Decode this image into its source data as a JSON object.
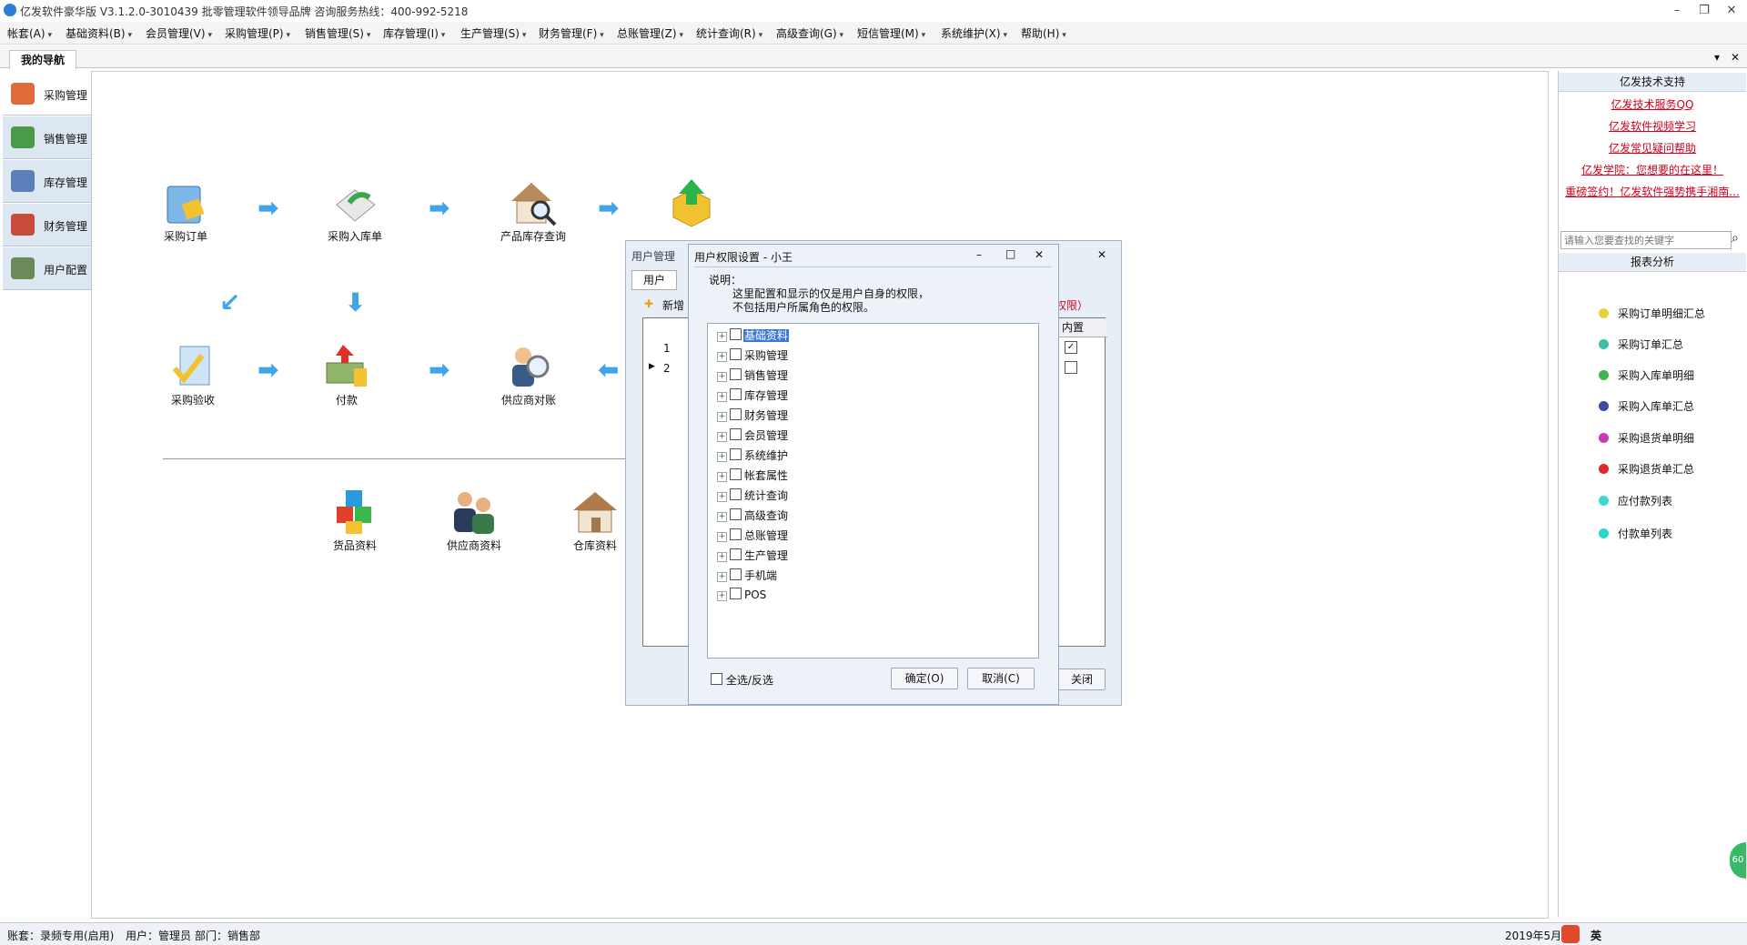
{
  "window": {
    "title": "亿发软件豪华版 V3.1.2.0-3010439 批零管理软件领导品牌 咨询服务热线：400-992-5218",
    "min": "–",
    "restore": "❐",
    "close": "✕"
  },
  "menu": [
    "帐套(A)",
    "基础资料(B)",
    "会员管理(V)",
    "采购管理(P)",
    "销售管理(S)",
    "库存管理(I)",
    "生产管理(S)",
    "财务管理(F)",
    "总账管理(Z)",
    "统计查询(R)",
    "高级查询(G)",
    "短信管理(M)",
    "系统维护(X)",
    "帮助(H)"
  ],
  "tabs": {
    "nav_tab": "我的导航",
    "dropdown": "▾",
    "close": "✕"
  },
  "leftnav": [
    {
      "label": "采购管理",
      "color": "#e06a3a"
    },
    {
      "label": "销售管理",
      "color": "#4a9a4a"
    },
    {
      "label": "库存管理",
      "color": "#5b7fb8"
    },
    {
      "label": "财务管理",
      "color": "#c84a3a"
    },
    {
      "label": "用户配置",
      "color": "#6a8a5a"
    }
  ],
  "flow": {
    "items": [
      "采购订单",
      "采购入库单",
      "产品库存查询",
      "",
      "采购验收",
      "付款",
      "供应商对账"
    ],
    "resources": [
      "货品资料",
      "供应商资料",
      "仓库资料"
    ],
    "arrow_right": "➡",
    "arrow_down": "⬇",
    "arrow_left": "⬅",
    "arrow_diag": "↙"
  },
  "userwin": {
    "title": "用户管理",
    "tab": "用户",
    "add": "新增",
    "perm_note": "权限）",
    "col_builtin": "内置",
    "rows": [
      {
        "no": "1",
        "mark": "✓"
      },
      {
        "no": "2",
        "mark": ""
      }
    ],
    "row_pointer": "▶",
    "close": "关闭",
    "x": "✕"
  },
  "dialog": {
    "title": "用户权限设置 - 小王",
    "note_label": "说明：",
    "note_line1": "这里配置和显示的仅是用户自身的权限，",
    "note_line2": "不包括用户所属角色的权限。",
    "tree": [
      "基础资料",
      "采购管理",
      "销售管理",
      "库存管理",
      "财务管理",
      "会员管理",
      "系统维护",
      "帐套属性",
      "统计查询",
      "高级查询",
      "总账管理",
      "生产管理",
      "手机端",
      "POS"
    ],
    "expander": "+",
    "select_all": "全选/反选",
    "ok": "确定(O)",
    "cancel": "取消(C)",
    "btn_min": "–",
    "btn_max": "□",
    "btn_close": "✕"
  },
  "right": {
    "support_title": "亿发技术支持",
    "links": [
      "亿发技术服务QQ",
      "亿发软件视频学习",
      "亿发常见疑问帮助",
      "亿发学院：您想要的在这里！",
      "重磅签约！亿发软件强势携手湘南..."
    ],
    "search_placeholder": "请输入您要查找的关键字",
    "search_icon_glyph": "⌕",
    "report_title": "报表分析",
    "reports": [
      {
        "label": "采购订单明细汇总",
        "color": "#e8d43a"
      },
      {
        "label": "采购订单汇总",
        "color": "#3fbfa8"
      },
      {
        "label": "采购入库单明细",
        "color": "#3fb54a"
      },
      {
        "label": "采购入库单汇总",
        "color": "#3a4aa8"
      },
      {
        "label": "采购退货单明细",
        "color": "#c43ab8"
      },
      {
        "label": "采购退货单汇总",
        "color": "#e02a2a"
      },
      {
        "label": "应付款列表",
        "color": "#3fd8d0"
      },
      {
        "label": "付款单列表",
        "color": "#2ad8c8"
      }
    ],
    "float_badge": "60"
  },
  "status": {
    "account": "账套：录频专用(启用)",
    "user": "用户：管理员",
    "dept": "部门：销售部",
    "date": "2019年5月",
    "ime": "英"
  }
}
